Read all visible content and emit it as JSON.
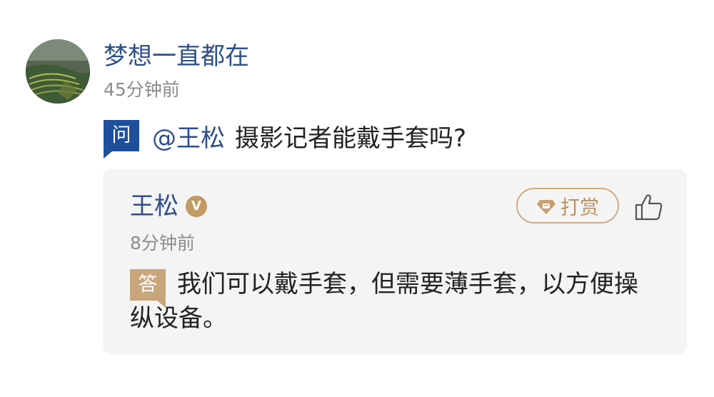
{
  "question": {
    "user_name": "梦想一直都在",
    "time": "45分钟前",
    "badge": "问",
    "mention": "@王松",
    "text": "摄影记者能戴手套吗?"
  },
  "answer": {
    "user_name": "王松",
    "verified_badge": "V",
    "time": "8分钟前",
    "tip_label": "打赏",
    "badge": "答",
    "text": "我们可以戴手套，但需要薄手套，以方便操纵设备。"
  },
  "colors": {
    "name_blue": "#2f4f8a",
    "question_badge": "#1f4f9c",
    "answer_badge": "#c9a57c",
    "tip_border": "#cfa982",
    "card_bg": "#f4f4f4",
    "time_gray": "#8c8c8c"
  },
  "icons": [
    "avatar-image",
    "verified-v-icon",
    "gem-icon",
    "thumbs-up-icon"
  ]
}
